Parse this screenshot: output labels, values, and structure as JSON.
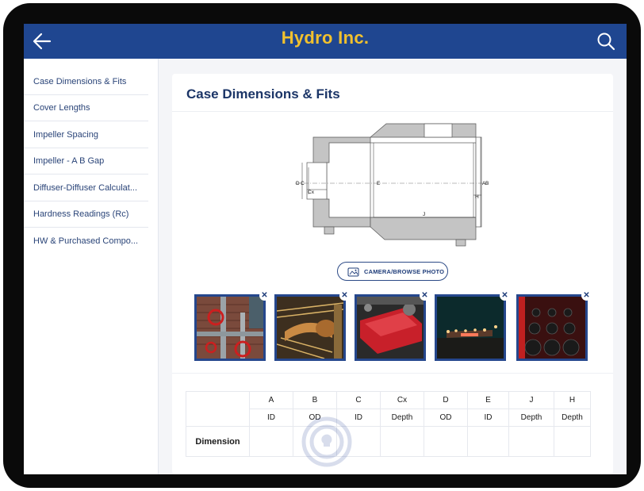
{
  "app": {
    "title": "Hydro Inc."
  },
  "sidebar": {
    "items": [
      {
        "label": "Case Dimensions & Fits"
      },
      {
        "label": "Cover Lengths"
      },
      {
        "label": "Impeller Spacing"
      },
      {
        "label": "Impeller -  A B Gap"
      },
      {
        "label": "Diffuser-Diffuser Calculat..."
      },
      {
        "label": "Hardness Readings (Rc)"
      },
      {
        "label": "HW & Purchased Compo..."
      }
    ]
  },
  "main": {
    "title": "Case Dimensions & Fits",
    "diagram_labels": {
      "a": "A",
      "b": "B",
      "c": "C",
      "d": "D",
      "cx": "Cx",
      "e": "E",
      "h": "H",
      "j": "J"
    },
    "camera_button": "CAMERA/BROWSE PHOTO",
    "photos": [
      {
        "name": "valves-photo"
      },
      {
        "name": "pipes-photo"
      },
      {
        "name": "engine-photo"
      },
      {
        "name": "night-plant-photo"
      },
      {
        "name": "bolts-photo"
      }
    ],
    "table": {
      "columns": [
        {
          "letter": "A",
          "type": "ID"
        },
        {
          "letter": "B",
          "type": "OD"
        },
        {
          "letter": "C",
          "type": "ID"
        },
        {
          "letter": "Cx",
          "type": "Depth"
        },
        {
          "letter": "D",
          "type": "OD"
        },
        {
          "letter": "E",
          "type": "ID"
        },
        {
          "letter": "J",
          "type": "Depth"
        },
        {
          "letter": "H",
          "type": "Depth"
        }
      ],
      "row_label": "Dimension"
    }
  },
  "icons": {
    "back": "arrow-left-icon",
    "search": "search-icon",
    "camera": "photo-icon",
    "close": "close-icon"
  },
  "colors": {
    "header": "#1f4690",
    "title": "#f2c12e",
    "accent": "#25478d"
  }
}
